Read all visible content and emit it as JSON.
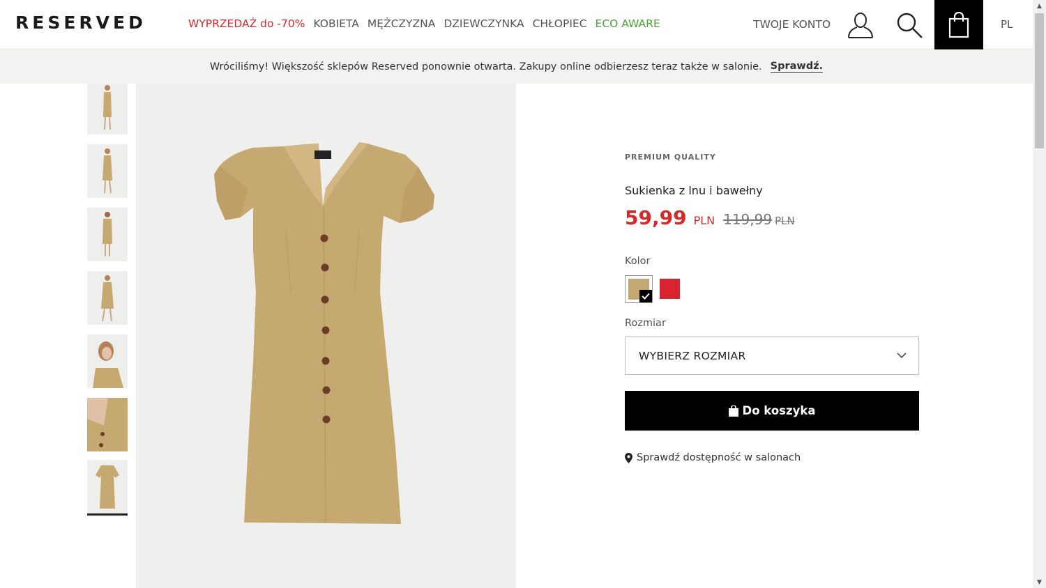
{
  "header": {
    "logo": "RESERVED",
    "nav": [
      {
        "label": "WYPRZEDAŻ do -70%",
        "color": "#d42a2a"
      },
      {
        "label": "KOBIETA"
      },
      {
        "label": "MĘŻCZYZNA"
      },
      {
        "label": "DZIEWCZYNKA"
      },
      {
        "label": "CHŁOPIEC"
      },
      {
        "label": "ECO AWARE",
        "color": "#4aa53a"
      }
    ],
    "account_label": "TWOJE KONTO",
    "language": "PL"
  },
  "infobar": {
    "message": "Wróciliśmy! Większość sklepów Reserved ponownie otwarta. Zakupy online odbierzesz teraz także w salonie.",
    "link": "Sprawdź."
  },
  "gallery": {
    "thumbnail_count": 7,
    "active_index": 6
  },
  "product": {
    "tag": "PREMIUM QUALITY",
    "name": "Sukienka z lnu i bawełny",
    "price": "59,99",
    "currency": "PLN",
    "old_price": "119,99",
    "old_currency": "PLN",
    "color_label": "Kolor",
    "colors": [
      {
        "hex": "#c4a771",
        "selected": true
      },
      {
        "hex": "#d9232f",
        "selected": false
      }
    ],
    "size_label": "Rozmiar",
    "size_placeholder": "WYBIERZ ROZMIAR",
    "add_to_cart": "Do koszyka",
    "store_availability": "Sprawdź dostępność w salonach"
  },
  "colors": {
    "accent_red": "#d42a2a",
    "eco_green": "#4aa53a",
    "dress": "#c6a871"
  }
}
